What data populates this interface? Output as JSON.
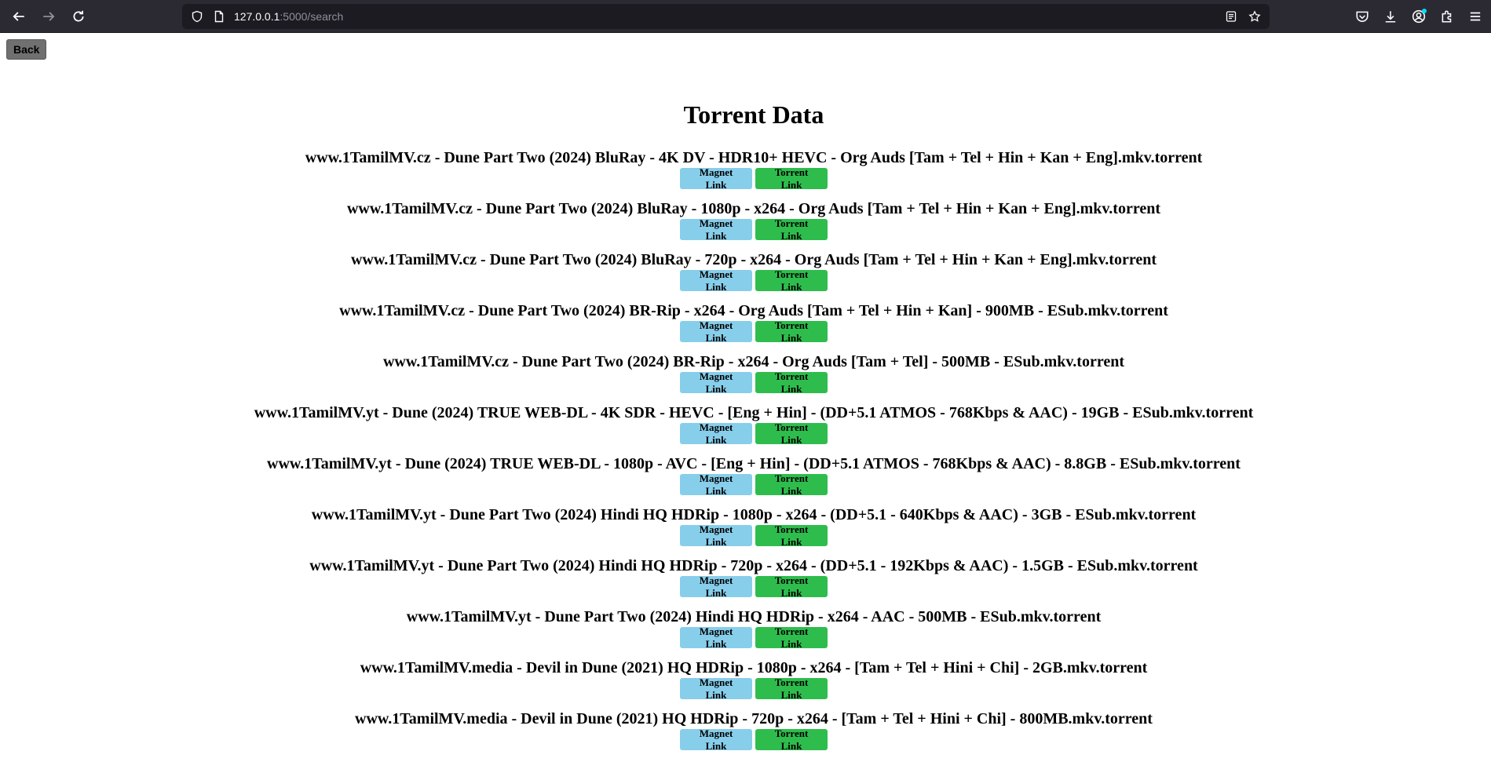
{
  "browser": {
    "url_host": "127.0.0.1",
    "url_path": ":5000/search"
  },
  "page": {
    "back_label": "Back",
    "title": "Torrent Data",
    "magnet_label": "Magnet Link",
    "torrent_label": "Torrent Link"
  },
  "results": [
    {
      "title": "www.1TamilMV.cz - Dune Part Two (2024) BluRay - 4K DV - HDR10+ HEVC - Org Auds [Tam + Tel + Hin + Kan + Eng].mkv.torrent"
    },
    {
      "title": "www.1TamilMV.cz - Dune Part Two (2024) BluRay - 1080p - x264 - Org Auds [Tam + Tel + Hin + Kan + Eng].mkv.torrent"
    },
    {
      "title": "www.1TamilMV.cz - Dune Part Two (2024) BluRay - 720p - x264 - Org Auds [Tam + Tel + Hin + Kan + Eng].mkv.torrent"
    },
    {
      "title": "www.1TamilMV.cz - Dune Part Two (2024) BR-Rip - x264 - Org Auds [Tam + Tel + Hin + Kan] - 900MB - ESub.mkv.torrent"
    },
    {
      "title": "www.1TamilMV.cz - Dune Part Two (2024) BR-Rip - x264 - Org Auds [Tam + Tel] - 500MB - ESub.mkv.torrent"
    },
    {
      "title": "www.1TamilMV.yt - Dune (2024) TRUE WEB-DL - 4K SDR - HEVC - [Eng + Hin] - (DD+5.1 ATMOS - 768Kbps & AAC) - 19GB - ESub.mkv.torrent"
    },
    {
      "title": "www.1TamilMV.yt - Dune (2024) TRUE WEB-DL - 1080p - AVC - [Eng + Hin] - (DD+5.1 ATMOS - 768Kbps & AAC) - 8.8GB - ESub.mkv.torrent"
    },
    {
      "title": "www.1TamilMV.yt - Dune Part Two (2024) Hindi HQ HDRip - 1080p - x264 - (DD+5.1 - 640Kbps & AAC) - 3GB - ESub.mkv.torrent"
    },
    {
      "title": "www.1TamilMV.yt - Dune Part Two (2024) Hindi HQ HDRip - 720p - x264 - (DD+5.1 - 192Kbps & AAC) - 1.5GB - ESub.mkv.torrent"
    },
    {
      "title": "www.1TamilMV.yt - Dune Part Two (2024) Hindi HQ HDRip - x264 - AAC - 500MB - ESub.mkv.torrent"
    },
    {
      "title": "www.1TamilMV.media - Devil in Dune (2021) HQ HDRip - 1080p - x264 - [Tam + Tel + Hini + Chi] - 2GB.mkv.torrent"
    },
    {
      "title": "www.1TamilMV.media - Devil in Dune (2021) HQ HDRip - 720p - x264 - [Tam + Tel + Hini + Chi] - 800MB.mkv.torrent"
    }
  ]
}
